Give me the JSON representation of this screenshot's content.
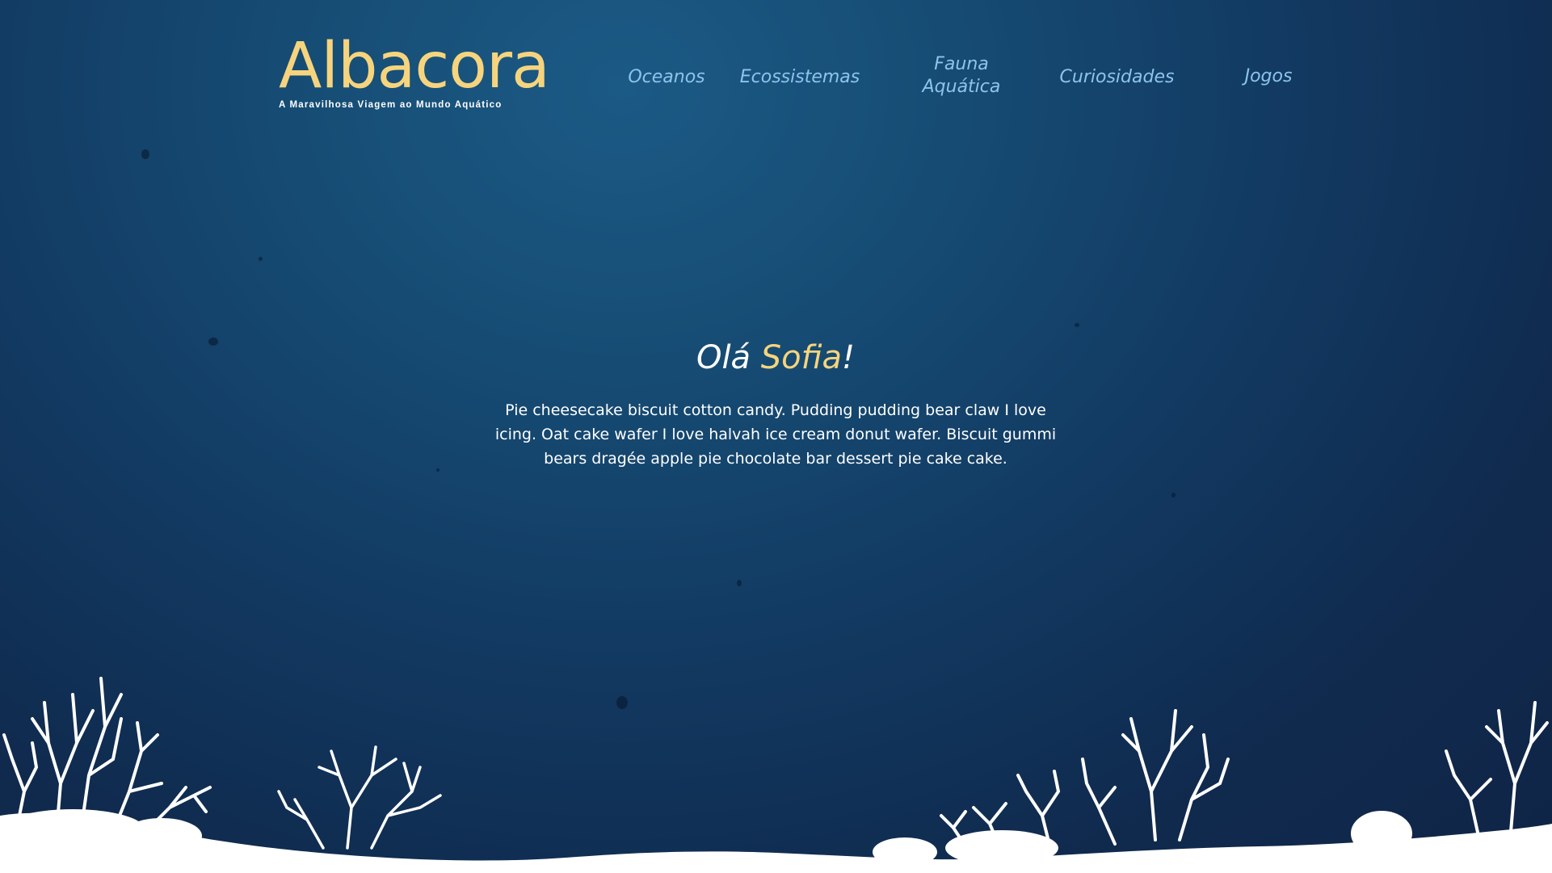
{
  "brand": {
    "title": "Albacora",
    "tagline": "A Maravilhosa Viagem ao Mundo Aquático"
  },
  "nav": {
    "items": [
      {
        "label": "Oceanos"
      },
      {
        "label": "Ecossistemas"
      },
      {
        "label": "Fauna Aquática"
      },
      {
        "label": "Curiosidades"
      },
      {
        "label": "Jogos"
      }
    ]
  },
  "hero": {
    "greeting_prefix": "Olá ",
    "user_name": "Sofia",
    "greeting_suffix": "!",
    "intro": "Pie cheesecake biscuit cotton candy. Pudding pudding bear claw I love icing. Oat cake wafer I love halvah ice cream donut wafer. Biscuit gummi bears dragée apple pie chocolate bar dessert pie cake cake."
  },
  "colors": {
    "background_top": "#1b5a85",
    "background_bottom": "#0f2446",
    "brand_yellow": "#f6d47d",
    "nav_blue": "#8ec4ec",
    "text_white": "#ffffff",
    "seabed_white": "#ffffff"
  },
  "icons": {
    "decoration": "coral-seabed-illustration"
  }
}
